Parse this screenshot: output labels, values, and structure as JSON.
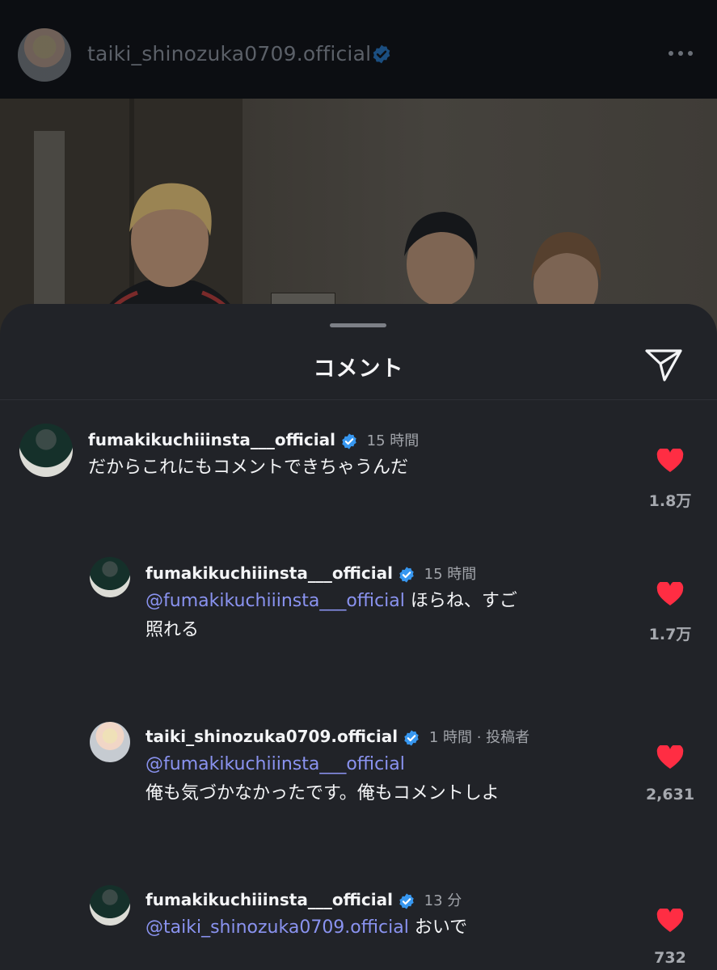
{
  "post": {
    "username": "taiki_shinozuka0709.official",
    "avatar_icon": "profile-avatar",
    "verified_icon": "verified-badge-icon",
    "more_icon": "more-options-icon"
  },
  "sheet": {
    "title": "コメント",
    "share_icon": "send-paper-plane-icon"
  },
  "comments": [
    {
      "username": "fumakikuchiiinsta___official",
      "time": "15 時間",
      "text": "だからこれにもコメントできちゃうんだ",
      "likes": "1.8万"
    },
    {
      "username": "fumakikuchiiinsta___official",
      "time": "15 時間",
      "mention": "@fumakikuchiiinsta___official",
      "text_line1": " ほらね、すご",
      "text_line2": "照れる",
      "likes": "1.7万"
    },
    {
      "username": "taiki_shinozuka0709.official",
      "time": "1 時間 · 投稿者",
      "mention": "@fumakikuchiiinsta___official",
      "text_line2": "俺も気づかなかったです。俺もコメントしよ",
      "likes": "2,631"
    },
    {
      "username": "fumakikuchiiinsta___official",
      "time": "13 分",
      "mention": "@taiki_shinozuka0709.official",
      "text_line1": " おいで",
      "likes": "732"
    }
  ],
  "colors": {
    "sheet_bg": "#212328",
    "heart": "#ff2d43",
    "mention": "#8a93f0",
    "verified": "#3797f0"
  }
}
